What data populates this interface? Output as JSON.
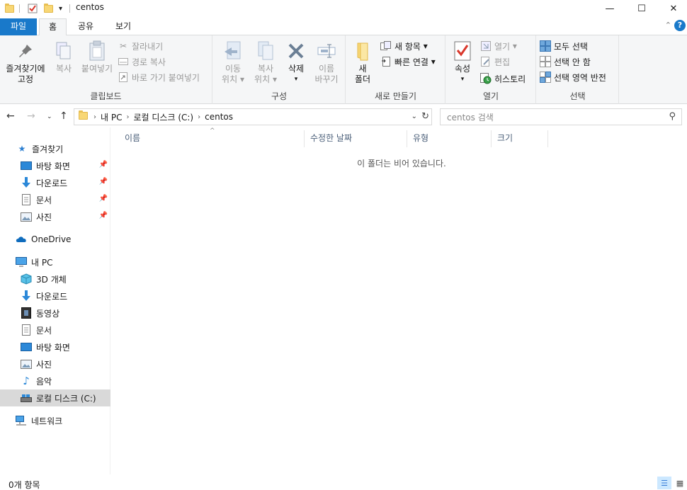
{
  "window": {
    "title": "centos",
    "controls": {
      "minimize": "—",
      "maximize": "☐",
      "close": "✕"
    }
  },
  "ribbon_tabs": [
    "파일",
    "홈",
    "공유",
    "보기"
  ],
  "ribbon": {
    "clipboard": {
      "label": "클립보드",
      "pin": [
        "즐겨찾기에",
        "고정"
      ],
      "copy": "복사",
      "paste": "붙여넣기",
      "cut": "잘라내기",
      "copy_path": "경로 복사",
      "paste_shortcut": "바로 가기 붙여넣기"
    },
    "organize": {
      "label": "구성",
      "move_to": [
        "이동",
        "위치"
      ],
      "copy_to": [
        "복사",
        "위치"
      ],
      "delete": "삭제",
      "rename": [
        "이름",
        "바꾸기"
      ]
    },
    "new": {
      "label": "새로 만들기",
      "new_folder": [
        "새",
        "폴더"
      ],
      "new_item": "새 항목",
      "easy_access": "빠른 연결"
    },
    "open": {
      "label": "열기",
      "properties": "속성",
      "open": "열기",
      "edit": "편집",
      "history": "히스토리"
    },
    "select": {
      "label": "선택",
      "select_all": "모두 선택",
      "select_none": "선택 안 함",
      "invert": "선택 영역 반전"
    }
  },
  "address": {
    "crumbs": [
      "내 PC",
      "로컬 디스크 (C:)",
      "centos"
    ],
    "search_placeholder": "centos 검색"
  },
  "nav": {
    "quick_access": "즐겨찾기",
    "quick_items": [
      "바탕 화면",
      "다운로드",
      "문서",
      "사진"
    ],
    "onedrive": "OneDrive",
    "this_pc": "내 PC",
    "pc_items": [
      "3D 개체",
      "다운로드",
      "동영상",
      "문서",
      "바탕 화면",
      "사진",
      "음악",
      "로컬 디스크 (C:)"
    ],
    "network": "네트워크"
  },
  "columns": [
    "이름",
    "수정한 날짜",
    "유형",
    "크기"
  ],
  "empty_message": "이 폴더는 비어 있습니다.",
  "status": {
    "count": "0개 항목"
  },
  "colors": {
    "accent": "#1979ca",
    "selected_bg": "#d9d9d9",
    "folder": "#f8d775"
  }
}
